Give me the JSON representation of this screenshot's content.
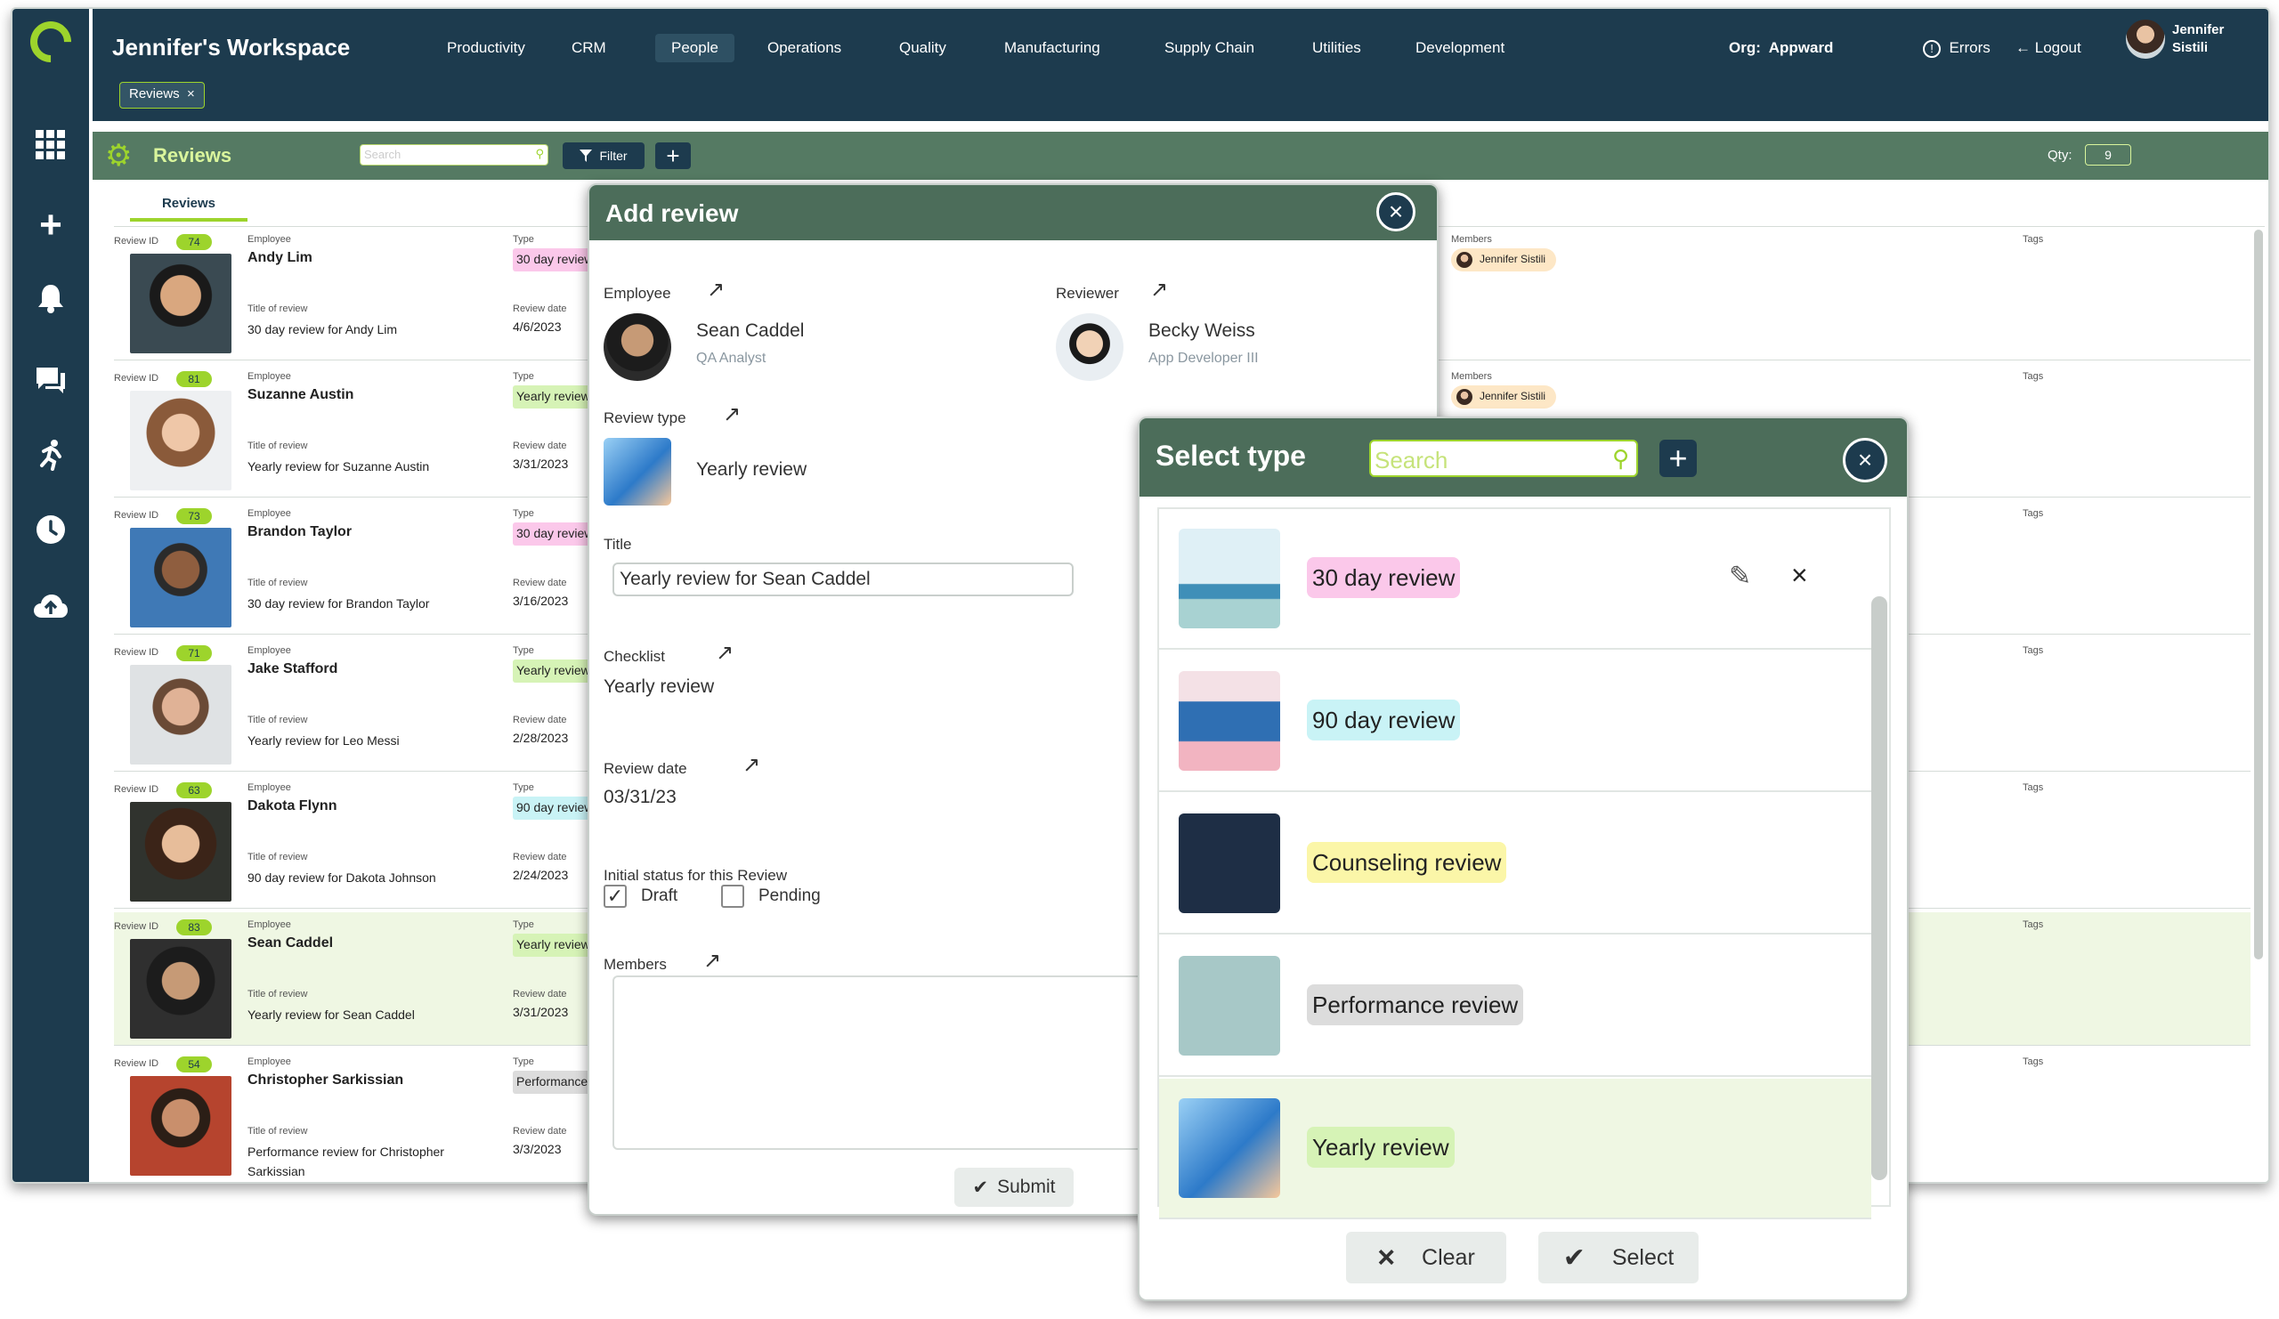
{
  "header": {
    "workspace_title": "Jennifer's Workspace",
    "menu": [
      "Productivity",
      "CRM",
      "People",
      "Operations",
      "Quality",
      "Manufacturing",
      "Supply Chain",
      "Utilities",
      "Development"
    ],
    "active_menu": "People",
    "org_label": "Org:",
    "org_value": "Appward",
    "errors_label": "Errors",
    "logout_label": "Logout",
    "user_name": "Jennifer Sistili",
    "open_tab_chip": "Reviews"
  },
  "toolbar": {
    "title": "Reviews",
    "search_placeholder": "Search",
    "filter_label": "Filter",
    "qty_label": "Qty:",
    "qty_value": "9"
  },
  "tabs": {
    "active": "Reviews"
  },
  "labels": {
    "review_id": "Review ID",
    "employee": "Employee",
    "type": "Type",
    "title_of_review": "Title of review",
    "review_date": "Review date",
    "members": "Members",
    "tags": "Tags"
  },
  "reviews": [
    {
      "id": "74",
      "employee": "Andy Lim",
      "type": "30 day review",
      "title": "30 day review for Andy Lim",
      "date": "4/6/2023",
      "member": "Jennifer Sistili"
    },
    {
      "id": "81",
      "employee": "Suzanne Austin",
      "type": "Yearly review",
      "title": "Yearly review for Suzanne Austin",
      "date": "3/31/2023",
      "member": "Jennifer Sistili"
    },
    {
      "id": "73",
      "employee": "Brandon Taylor",
      "type": "30 day review",
      "title": "30 day review for Brandon Taylor",
      "date": "3/16/2023",
      "member": ""
    },
    {
      "id": "71",
      "employee": "Jake Stafford",
      "type": "Yearly review",
      "title": "Yearly review for Leo Messi",
      "date": "2/28/2023",
      "member": ""
    },
    {
      "id": "63",
      "employee": "Dakota Flynn",
      "type": "90 day review",
      "title": "90 day review for Dakota Johnson",
      "date": "2/24/2023",
      "member": ""
    },
    {
      "id": "83",
      "employee": "Sean Caddel",
      "type": "Yearly review",
      "title": "Yearly review for Sean Caddel",
      "date": "3/31/2023",
      "member": ""
    },
    {
      "id": "54",
      "employee": "Christopher Sarkissian",
      "type": "Performance",
      "title": "Performance review for Christopher Sarkissian",
      "date": "3/3/2023",
      "member": ""
    }
  ],
  "add_review": {
    "title": "Add review",
    "employee_label": "Employee",
    "employee_name": "Sean Caddel",
    "employee_role": "QA Analyst",
    "reviewer_label": "Reviewer",
    "reviewer_name": "Becky Weiss",
    "reviewer_role": "App Developer III",
    "review_type_label": "Review type",
    "review_type_value": "Yearly review",
    "title_label": "Title",
    "title_value": "Yearly review for Sean Caddel",
    "checklist_label": "Checklist",
    "checklist_value": "Yearly review",
    "review_date_label": "Review date",
    "review_date_value": "03/31/23",
    "status_label": "Initial status for this Review",
    "status_draft": "Draft",
    "status_pending": "Pending",
    "draft_checked": true,
    "pending_checked": false,
    "members_label": "Members",
    "submit_label": "Submit"
  },
  "select_type": {
    "title": "Select type",
    "search_placeholder": "Search",
    "items": [
      {
        "label": "30 day review",
        "color": "#fbc8ea"
      },
      {
        "label": "90 day review",
        "color": "#c9f3f6"
      },
      {
        "label": "Counseling review",
        "color": "#fbf6a8"
      },
      {
        "label": "Performance review",
        "color": "#dcdcdc"
      },
      {
        "label": "Yearly review",
        "color": "#d6f3b6"
      }
    ],
    "clear_label": "Clear",
    "select_label": "Select"
  },
  "colors": {
    "navy": "#1d3b4e",
    "accent": "#9dd42c",
    "toolbar": "#557a63",
    "modal_header": "#4c6d5a"
  }
}
